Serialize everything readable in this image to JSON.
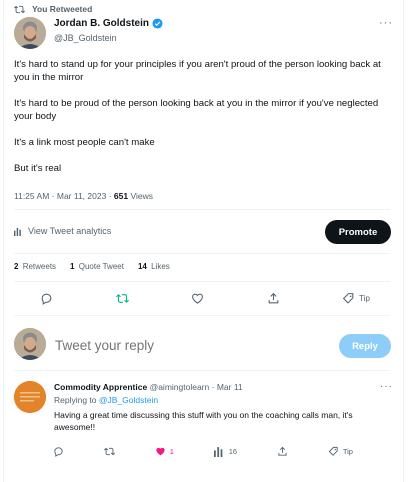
{
  "retweet_header": {
    "label": "You Retweeted",
    "icon": "retweet-icon"
  },
  "author": {
    "name": "Jordan B. Goldstein",
    "handle": "@JB_Goldstein",
    "verified": true
  },
  "tweet": {
    "paragraphs": [
      "It's hard to stand up for your principles if you aren't proud of the person looking back at you in the mirror",
      "It's hard to be proud of the person looking back at you in the mirror if you've neglected your body",
      "It's a link most people can't make",
      "But it's real"
    ],
    "time": "11:25 AM",
    "date": "Mar 11, 2023",
    "views_count": "651",
    "views_label": "Views"
  },
  "analytics": {
    "label": "View Tweet analytics",
    "promote_label": "Promote"
  },
  "stats": {
    "retweets_count": "2",
    "retweets_label": "Retweets",
    "quotes_count": "1",
    "quotes_label": "Quote Tweet",
    "likes_count": "14",
    "likes_label": "Likes"
  },
  "main_actions": {
    "tip_label": "Tip"
  },
  "reply_box": {
    "placeholder": "Tweet your reply",
    "button_label": "Reply"
  },
  "comment": {
    "name": "Commodity Apprentice",
    "handle": "@aimingtolearn",
    "date": "Mar 11",
    "replying_prefix": "Replying to",
    "replying_to": "@JB_Goldstein",
    "text": "Having a great time discussing this stuff with you on the coaching calls man, it's awesome!!",
    "likes": "1",
    "views": "16",
    "tip_label": "Tip"
  },
  "colors": {
    "accent": "#1d9bf0",
    "retweet_green": "#00ba7c",
    "like_pink": "#f91880",
    "text_secondary": "#536471",
    "promote_bg": "#0f1419",
    "reply_disabled": "#8ecdf8"
  }
}
